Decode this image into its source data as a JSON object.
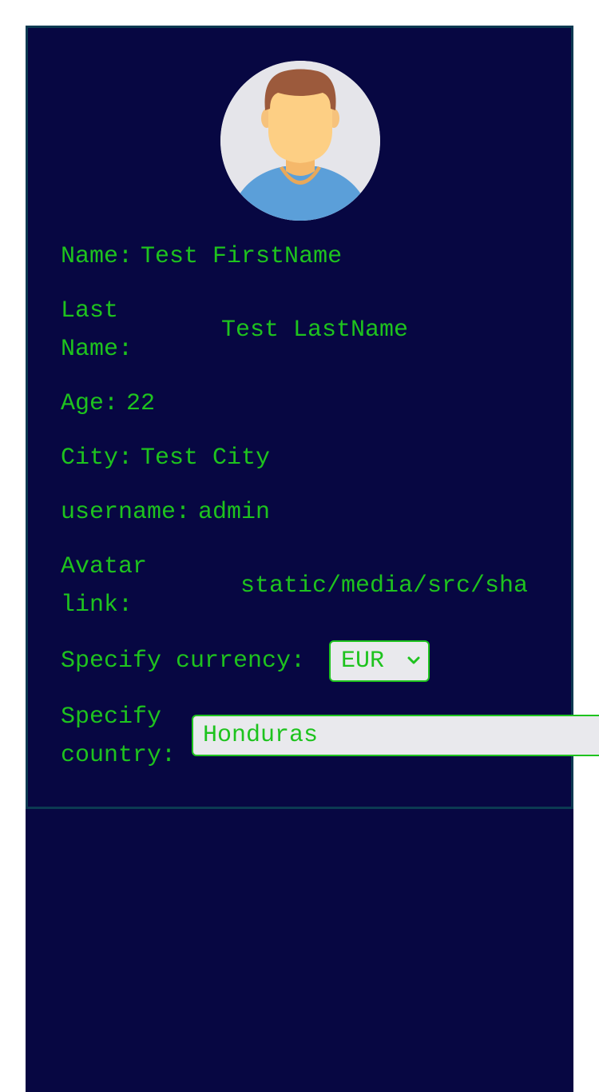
{
  "profile": {
    "avatar_icon": "user-avatar-icon",
    "name_label": "Name:",
    "name_value": "Test FirstName",
    "last_name_label_line1": "Last",
    "last_name_label_line2": "Name:",
    "last_name_value": "Test LastName",
    "age_label": "Age:",
    "age_value": "22",
    "city_label": "City:",
    "city_value": "Test City",
    "username_label": "username:",
    "username_value": "admin",
    "avatar_link_label_line1": "Avatar",
    "avatar_link_label_line2": "link:",
    "avatar_link_value": "static/media/src/sha",
    "currency_label": "Specify currency:",
    "currency_value": "EUR",
    "country_label_line1": "Specify",
    "country_label_line2": "country:",
    "country_value": "Honduras"
  },
  "colors": {
    "background": "#070742",
    "text": "#1ec31e",
    "card_border": "#0b3a52",
    "input_background": "#e9e9ed"
  }
}
